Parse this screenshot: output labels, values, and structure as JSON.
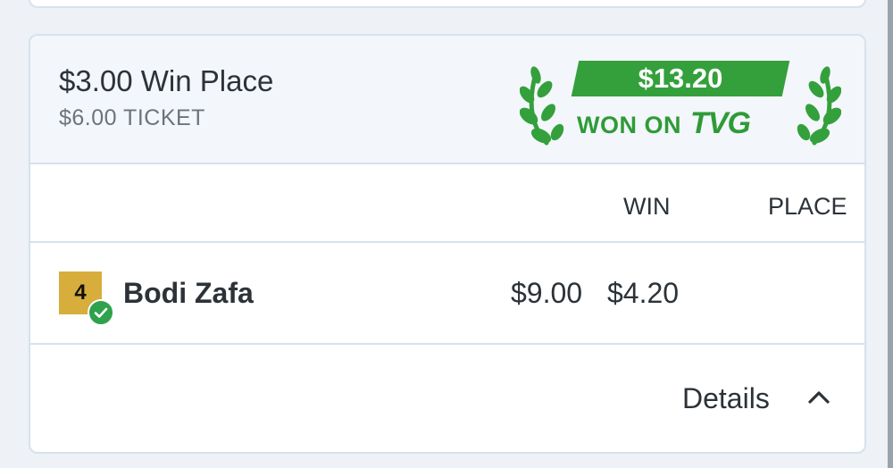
{
  "bet": {
    "title": "$3.00 Win Place",
    "ticket": "$6.00 TICKET"
  },
  "win_badge": {
    "amount": "$13.20",
    "won_on_label": "WON ON",
    "brand": "TVG",
    "color": "#34a03c"
  },
  "columns": {
    "win": "WIN",
    "place": "PLACE"
  },
  "runner": {
    "saddle_number": "4",
    "saddle_color": "#d7ae3b",
    "name": "Bodi Zafa",
    "win_payout": "$9.00",
    "place_payout": "$4.20",
    "status_icon": "check-circle-icon"
  },
  "details": {
    "label": "Details",
    "icon": "chevron-up-icon"
  }
}
